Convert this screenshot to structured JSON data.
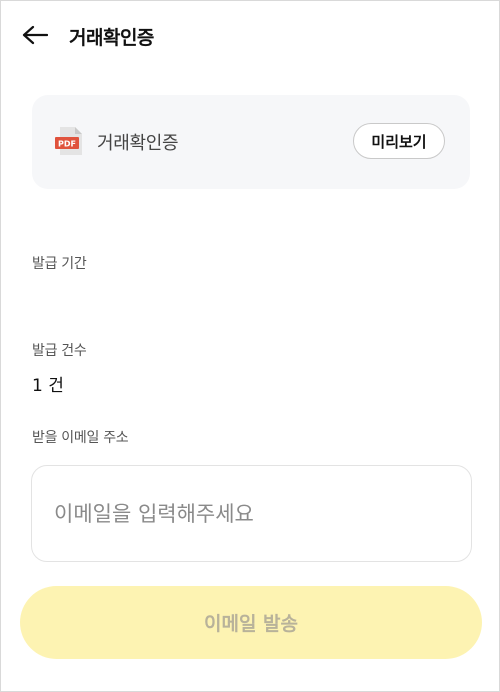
{
  "header": {
    "title": "거래확인증",
    "back_icon": "arrow-left-icon"
  },
  "document": {
    "icon": "pdf-file-icon",
    "icon_text": "PDF",
    "name": "거래확인증",
    "preview_label": "미리보기"
  },
  "issue_period": {
    "label": "발급 기간",
    "value": ""
  },
  "issue_count": {
    "label": "발급 건수",
    "value": "1 건"
  },
  "email": {
    "label": "받을 이메일 주소",
    "value": "",
    "placeholder": "이메일을 입력해주세요"
  },
  "send_button": {
    "label": "이메일 발송",
    "enabled": false
  },
  "colors": {
    "send_button_bg_disabled": "#fdf3b2",
    "send_button_text_disabled": "#b8b29a",
    "card_bg": "#f6f7f9",
    "pdf_red": "#e0533d"
  }
}
